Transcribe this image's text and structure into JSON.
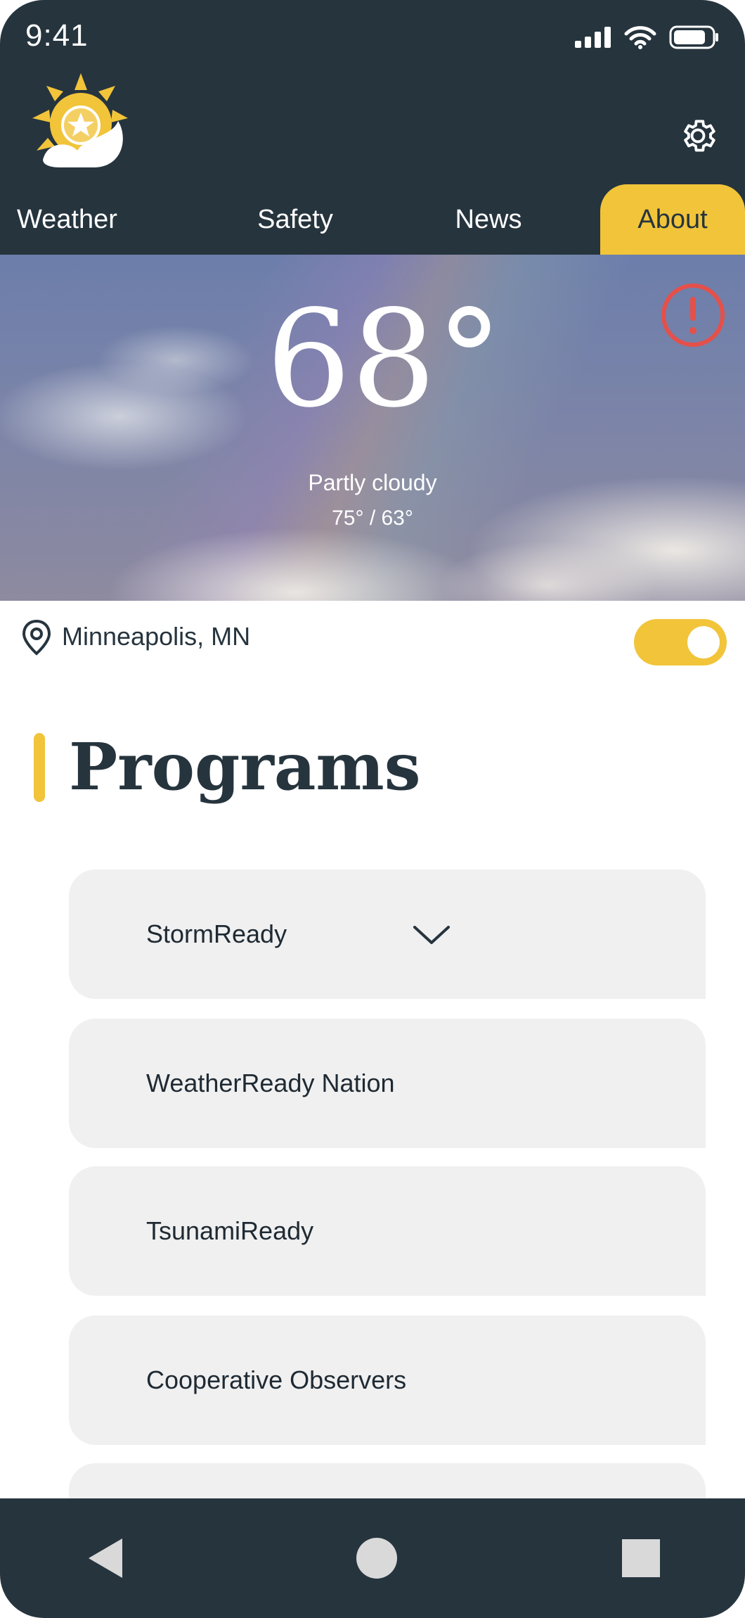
{
  "status_bar": {
    "time": "9:41"
  },
  "tabs": [
    {
      "label": "Weather",
      "active": false
    },
    {
      "label": "Safety",
      "active": false
    },
    {
      "label": "News",
      "active": false
    },
    {
      "label": "About",
      "active": true
    }
  ],
  "weather": {
    "temperature": "68°",
    "condition": "Partly cloudy",
    "high_low": "75° / 63°"
  },
  "location": {
    "name": "Minneapolis, MN",
    "toggle_on": true
  },
  "programs": {
    "title": "Programs",
    "items": [
      {
        "label": "StormReady",
        "expandable": true
      },
      {
        "label": "WeatherReady Nation"
      },
      {
        "label": "TsunamiReady"
      },
      {
        "label": "Cooperative Observers"
      },
      {
        "label": ""
      }
    ]
  },
  "icons": {
    "logo": "sun-cloud-star-logo",
    "settings": "gear-icon",
    "alert": "exclamation-circle-icon",
    "location": "location-pin-icon",
    "chevron": "chevron-down-icon",
    "nav_back": "triangle-back-icon",
    "nav_home": "circle-home-icon",
    "nav_recent": "square-recent-icon"
  },
  "colors": {
    "header_bg": "#26343e",
    "accent_yellow": "#f1c43a",
    "alert_red": "#e5504a",
    "card_bg": "#f0f0f0"
  }
}
